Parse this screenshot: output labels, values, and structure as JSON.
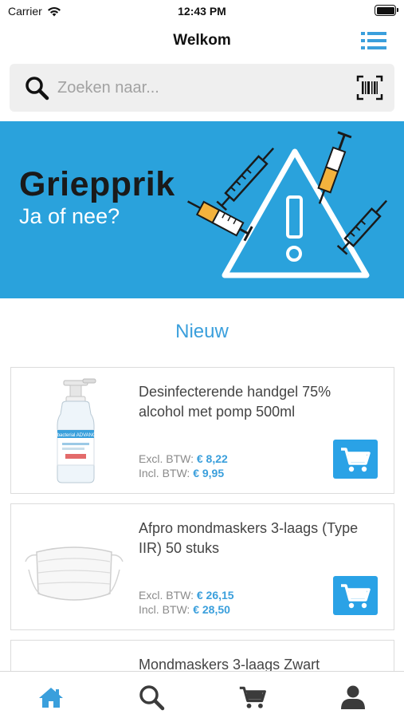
{
  "status_bar": {
    "carrier": "Carrier",
    "time": "12:43 PM"
  },
  "nav": {
    "title": "Welkom",
    "menu_icon": "list-icon"
  },
  "search": {
    "placeholder": "Zoeken naar...",
    "value": "",
    "search_icon": "search-icon",
    "barcode_icon": "barcode-scan-icon"
  },
  "banner": {
    "title": "Griepprik",
    "subtitle": "Ja of nee?",
    "background_color": "#2aa2dc",
    "icons": [
      "warning-triangle-icon",
      "syringe-icon"
    ]
  },
  "section": {
    "title": "Nieuw"
  },
  "products": [
    {
      "name": "Desinfecterende handgel 75% alcohol met pomp 500ml",
      "excl_label": "Excl. BTW:",
      "excl_price": "€ 8,22",
      "incl_label": "Incl. BTW:",
      "incl_price": "€ 9,95",
      "image_icon": "handgel-bottle-image",
      "image_text": "Antibacterial ADVANCED"
    },
    {
      "name": "Afpro mondmaskers 3-laags (Type IIR) 50 stuks",
      "excl_label": "Excl. BTW:",
      "excl_price": "€ 26,15",
      "incl_label": "Incl. BTW:",
      "incl_price": "€ 28,50",
      "image_icon": "face-mask-image"
    },
    {
      "name": "Mondmaskers 3-laags Zwart"
    }
  ],
  "tabs": [
    {
      "name": "home",
      "icon": "home-icon",
      "active": true
    },
    {
      "name": "search",
      "icon": "search-icon",
      "active": false
    },
    {
      "name": "cart",
      "icon": "cart-icon",
      "active": false
    },
    {
      "name": "account",
      "icon": "user-icon",
      "active": false
    }
  ],
  "colors": {
    "accent": "#2aa2e6",
    "active_tab": "#3a9fdc",
    "inactive_tab": "#3b3b3b",
    "price": "#3a9fdc"
  }
}
